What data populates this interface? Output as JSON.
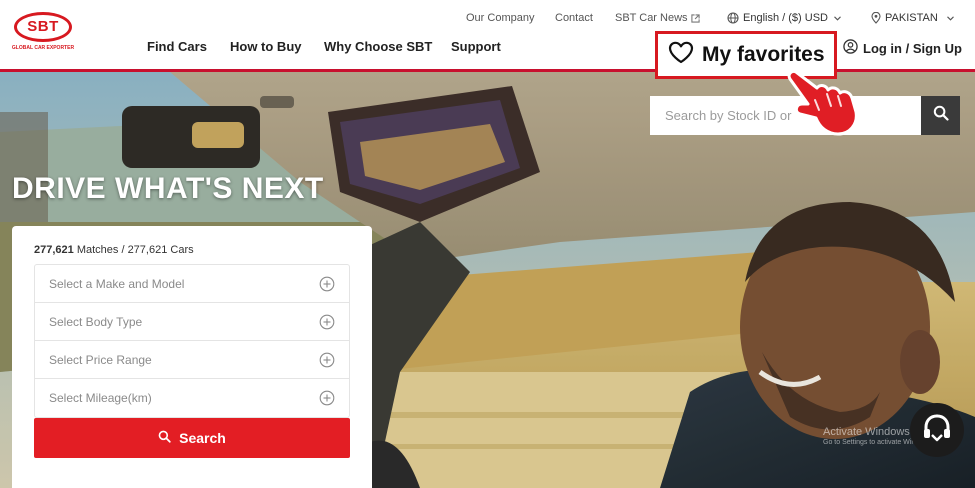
{
  "brand": {
    "logo_text": "SBT",
    "tagline": "GLOBAL CAR EXPORTER",
    "accent_color": "#d71920"
  },
  "topbar": {
    "our_company": "Our Company",
    "contact": "Contact",
    "car_news": "SBT Car News",
    "language_currency": "English / ($) USD",
    "country": "PAKISTAN"
  },
  "nav": {
    "find_cars": "Find Cars",
    "how_to_buy": "How to Buy",
    "why_choose": "Why Choose SBT",
    "support": "Support"
  },
  "favorites": {
    "label": "My favorites"
  },
  "account": {
    "login": "Log in / Sign Up"
  },
  "hero": {
    "title": "DRIVE WHAT'S NEXT"
  },
  "stock_search": {
    "placeholder": "Search by Stock ID or"
  },
  "search_panel": {
    "matches_count": "277,621",
    "matches_label": "Matches / 277,621 Cars",
    "selectors": [
      {
        "label": "Select a Make and Model"
      },
      {
        "label": "Select Body Type"
      },
      {
        "label": "Select Price Range"
      },
      {
        "label": "Select Mileage(km)"
      }
    ],
    "search_label": "Search"
  },
  "watermark": {
    "title": "Activate Windows",
    "subtitle": "Go to Settings to activate Windows."
  },
  "icons": {
    "heart": "heart-icon",
    "user": "user-circle-icon",
    "globe": "globe-icon",
    "location": "location-pin-icon",
    "external": "external-link-icon",
    "search": "search-icon",
    "plus": "plus-circle-icon",
    "chat": "chat-support-icon",
    "hand": "pointing-hand-icon"
  }
}
